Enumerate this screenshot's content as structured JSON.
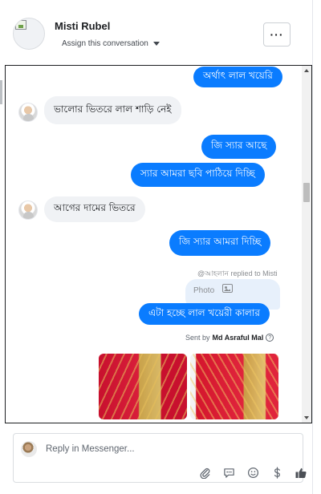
{
  "header": {
    "contact_name": "Misti Rubel",
    "assign_label": "Assign this conversation",
    "more_label": "···"
  },
  "messages": {
    "m1": "অর্থাৎ লাল খয়েরি",
    "m2": "ভালোর ভিতরে লাল শাড়ি নেই",
    "m3": "জি স্যার আছে",
    "m4": "স্যার আমরা ছবি পাঠিয়ে দিচ্ছি",
    "m5": "আগের দামের  ভিতরে",
    "m6": "জি স্যার আমরা দিচ্ছি",
    "reply_note": "‎@আহলান replied to Misti",
    "reply_photo_label": "Photo",
    "m7": "এটা হচ্ছে লাল খয়েরী কালার",
    "sent_by_prefix": "Sent by",
    "sent_by_name": "Md Asraful Mal",
    "help_glyph": "?"
  },
  "composer": {
    "placeholder": "Reply in Messenger..."
  },
  "icons": {
    "attach": "paperclip-icon",
    "saved_replies": "speech-bubble-icon",
    "emoji": "smiley-icon",
    "payment": "dollar-icon",
    "like": "thumbs-up-icon"
  },
  "colors": {
    "outgoing_bubble": "#0a7cff",
    "incoming_bubble": "#f0f2f5",
    "reply_card": "#e7f0fb"
  }
}
